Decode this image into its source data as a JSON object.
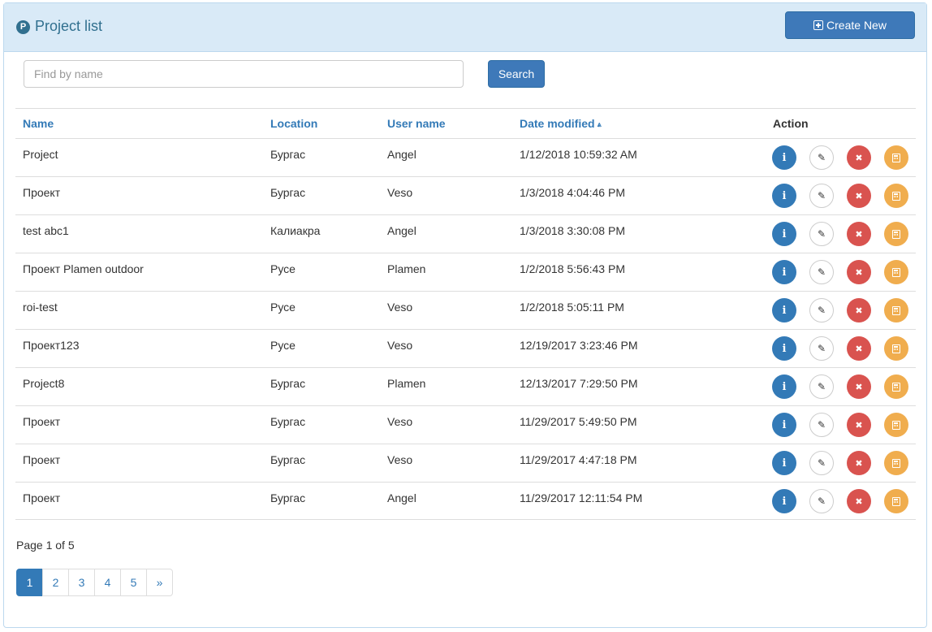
{
  "header": {
    "logo_letter": "P",
    "title": "Project list",
    "create_label": "Create New"
  },
  "search": {
    "placeholder": "Find by name",
    "button_label": "Search"
  },
  "table": {
    "columns": {
      "name": "Name",
      "location": "Location",
      "user": "User name",
      "date": "Date modified",
      "action": "Action"
    },
    "sort": {
      "column": "date",
      "direction": "ascending-indicator"
    },
    "rows": [
      {
        "name": "Project",
        "location": "Бургас",
        "user": "Angel",
        "date": "1/12/2018 10:59:32 AM"
      },
      {
        "name": "Проект",
        "location": "Бургас",
        "user": "Veso",
        "date": "1/3/2018 4:04:46 PM"
      },
      {
        "name": "test abc1",
        "location": "Калиакра",
        "user": "Angel",
        "date": "1/3/2018 3:30:08 PM"
      },
      {
        "name": "Проект Plamen outdoor",
        "location": "Русе",
        "user": "Plamen",
        "date": "1/2/2018 5:56:43 PM"
      },
      {
        "name": "roi-test",
        "location": "Русе",
        "user": "Veso",
        "date": "1/2/2018 5:05:11 PM"
      },
      {
        "name": "Проект123",
        "location": "Русе",
        "user": "Veso",
        "date": "12/19/2017 3:23:46 PM"
      },
      {
        "name": "Project8",
        "location": "Бургас",
        "user": "Plamen",
        "date": "12/13/2017 7:29:50 PM"
      },
      {
        "name": "Проект",
        "location": "Бургас",
        "user": "Veso",
        "date": "11/29/2017 5:49:50 PM"
      },
      {
        "name": "Проект",
        "location": "Бургас",
        "user": "Veso",
        "date": "11/29/2017 4:47:18 PM"
      },
      {
        "name": "Проект",
        "location": "Бургас",
        "user": "Angel",
        "date": "11/29/2017 12:11:54 PM"
      }
    ],
    "row_actions": [
      "info-icon",
      "pencil-icon",
      "close-icon",
      "calculator-icon"
    ]
  },
  "pagination": {
    "info": "Page 1 of 5",
    "pages": [
      "1",
      "2",
      "3",
      "4",
      "5",
      "»"
    ],
    "current": "1"
  },
  "colors": {
    "primary": "#3e79b9",
    "heading_bg": "#d9eaf7",
    "danger": "#d9534f",
    "warning": "#f0ad4e",
    "link": "#337ab7"
  }
}
